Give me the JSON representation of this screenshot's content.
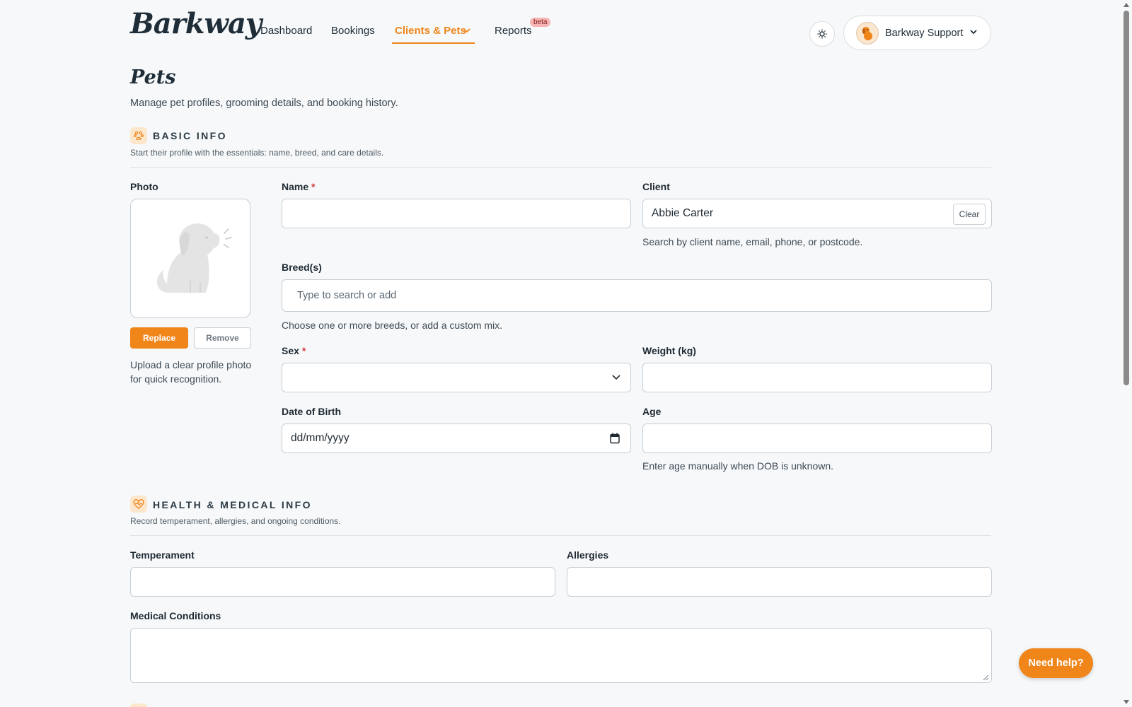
{
  "app": {
    "logo": "Barkway"
  },
  "nav": {
    "items": [
      {
        "label": "Dashboard"
      },
      {
        "label": "Bookings"
      },
      {
        "label": "Clients & Pets"
      },
      {
        "label": "Reports"
      }
    ],
    "beta_badge": "beta"
  },
  "user": {
    "name": "Barkway Support"
  },
  "page": {
    "title": "Pets",
    "subtitle": "Manage pet profiles, grooming details, and booking history."
  },
  "basic": {
    "title": "BASIC INFO",
    "subtitle": "Start their profile with the essentials: name, breed, and care details.",
    "photo_label": "Photo",
    "replace_label": "Replace",
    "remove_label": "Remove",
    "photo_help": "Upload a clear profile photo for quick recognition.",
    "name_label": "Name",
    "name_value": "",
    "client_label": "Client",
    "client_value": "Abbie Carter",
    "clear_label": "Clear",
    "client_help": "Search by client name, email, phone, or postcode.",
    "breed_label": "Breed(s)",
    "breed_placeholder": "Type to search or add",
    "breed_help": "Choose one or more breeds, or add a custom mix.",
    "sex_label": "Sex",
    "sex_value": "",
    "weight_label": "Weight (kg)",
    "weight_value": "",
    "dob_label": "Date of Birth",
    "dob_placeholder": "dd/mm/yyyy",
    "age_label": "Age",
    "age_value": "",
    "age_help": "Enter age manually when DOB is unknown.",
    "required_mark": "*"
  },
  "health": {
    "title": "HEALTH & MEDICAL INFO",
    "subtitle": "Record temperament, allergies, and ongoing conditions.",
    "temperament_label": "Temperament",
    "allergies_label": "Allergies",
    "medical_label": "Medical Conditions"
  },
  "help_button": "Need help?",
  "colors": {
    "accent": "#f0851a",
    "background": "#f6f8f9",
    "text": "#1e2d38"
  }
}
